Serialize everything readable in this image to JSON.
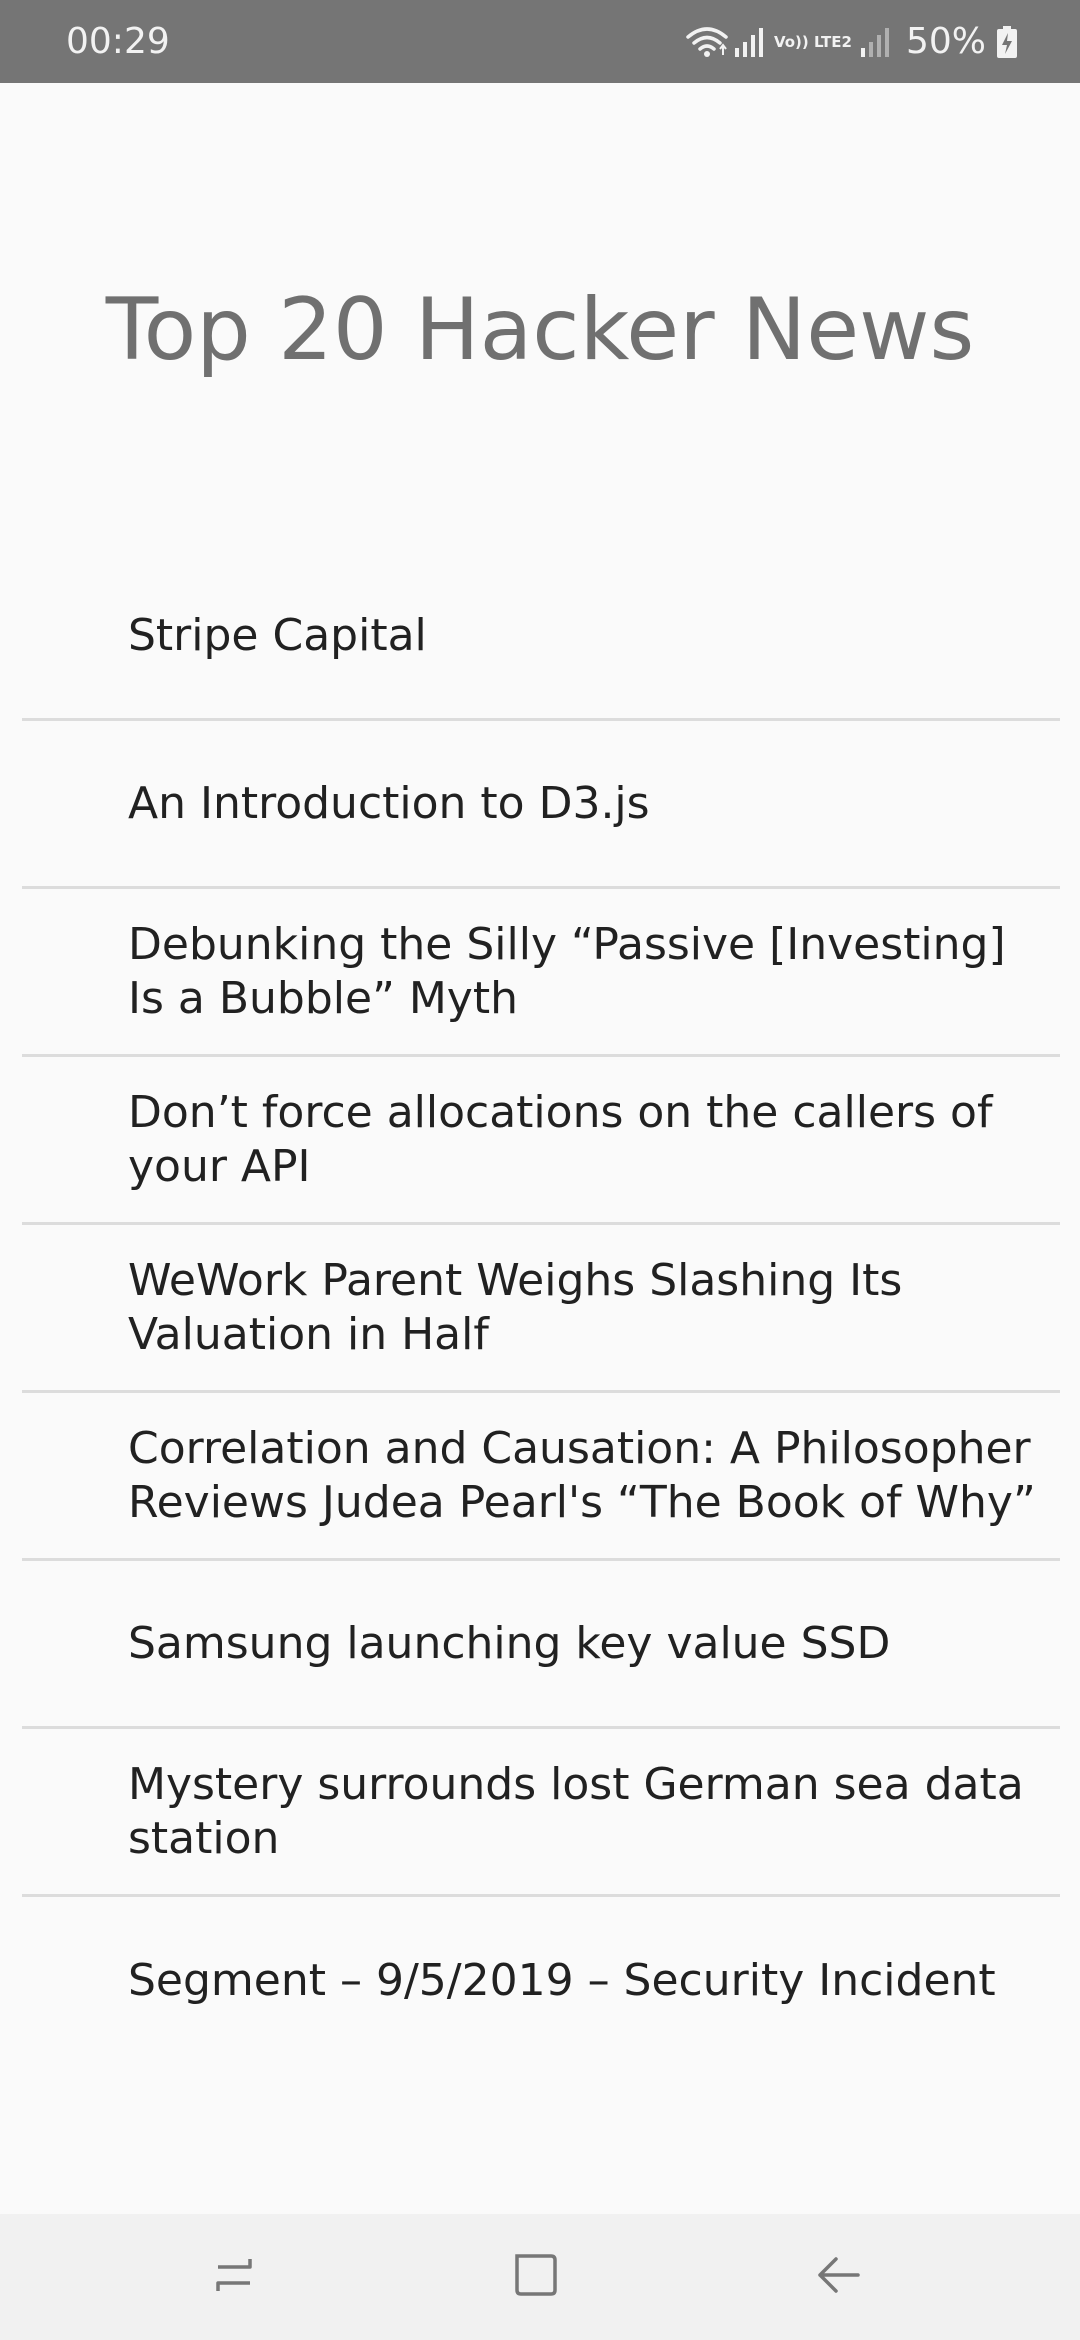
{
  "status_bar": {
    "time": "00:29",
    "network": "Vo)) LTE2",
    "battery": "50%",
    "icons": [
      "wifi-icon",
      "signal-icon",
      "signal-icon",
      "battery-charging-icon"
    ]
  },
  "header": {
    "title": "Top 20 Hacker News"
  },
  "news": {
    "items": [
      {
        "title": "Stripe Capital"
      },
      {
        "title": "An Introduction to D3.js"
      },
      {
        "title": "Debunking the Silly “Passive [Investing] Is a Bubble” Myth"
      },
      {
        "title": "Don’t force allocations on the callers of your API"
      },
      {
        "title": "WeWork Parent Weighs Slashing Its Valuation in Half"
      },
      {
        "title": "Correlation and Causation: A Philosopher Reviews Judea Pearl's “The Book of Why”"
      },
      {
        "title": "Samsung launching key value SSD"
      },
      {
        "title": "Mystery surrounds lost German sea data station"
      },
      {
        "title": "Segment – 9/5/2019 – Security Incident"
      }
    ]
  },
  "nav_bar": {
    "icons": [
      "recent-apps-icon",
      "home-icon",
      "back-icon"
    ]
  },
  "colors": {
    "status_bar": "#757575",
    "background": "#fafafa",
    "title": "#707070",
    "divider": "#dcdcdc",
    "nav_bar": "#f1f1f1"
  }
}
